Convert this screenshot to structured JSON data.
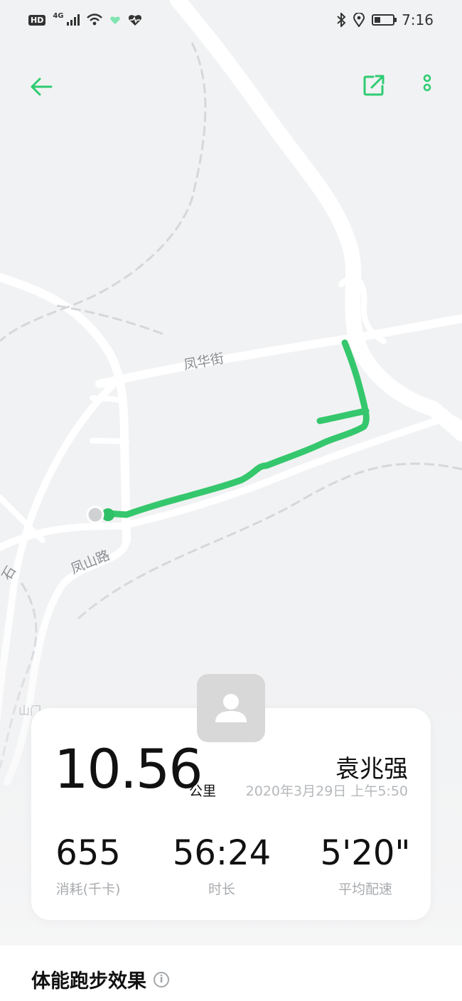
{
  "status_bar": {
    "hd_badge": "HD",
    "network": "4G",
    "time": "7:16",
    "icons": [
      "hd-icon",
      "signal-icon",
      "wifi-icon",
      "heart-app-icon",
      "heartbeat-icon",
      "bluetooth-icon",
      "location-icon",
      "battery-icon"
    ],
    "battery_level": 0.3
  },
  "toolbar": {
    "back_icon": "arrow-left-icon",
    "share_icon": "share-export-icon",
    "more_icon": "more-vertical-icon",
    "accent_color": "#2ecc71"
  },
  "map": {
    "labels": [
      "凤华街",
      "凤山路",
      "山门",
      "石"
    ],
    "route_color": "#35c76d"
  },
  "summary": {
    "distance": "10.56",
    "distance_unit": "公里",
    "user_name": "袁兆强",
    "datetime": "2020年3月29日 上午5:50",
    "avatar_icon": "user-placeholder-icon"
  },
  "stats": [
    {
      "value": "655",
      "label": "消耗(千卡)"
    },
    {
      "value": "56:24",
      "label": "时长"
    },
    {
      "value": "5'20\"",
      "label": "平均配速"
    }
  ],
  "section": {
    "title": "体能跑步效果",
    "info_icon": "info-icon"
  }
}
